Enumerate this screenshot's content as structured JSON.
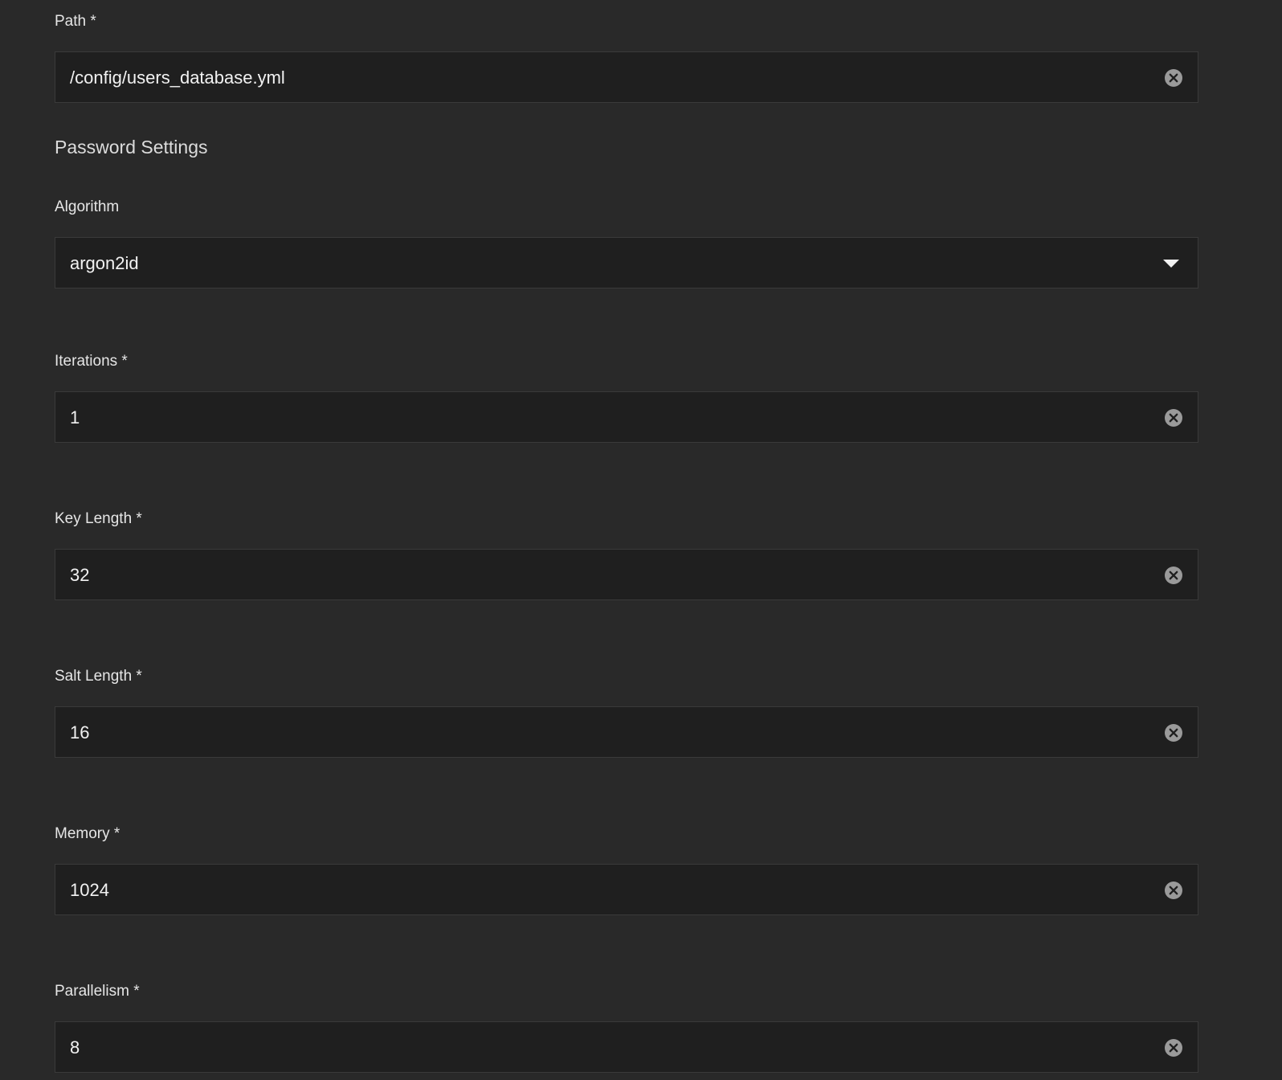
{
  "path": {
    "label": "Path *",
    "value": "/config/users_database.yml",
    "clear_icon": "close-circle-icon"
  },
  "password_settings": {
    "heading": "Password Settings",
    "algorithm": {
      "label": "Algorithm",
      "value": "argon2id",
      "dropdown_icon": "chevron-down-icon"
    },
    "iterations": {
      "label": "Iterations *",
      "value": "1",
      "clear_icon": "close-circle-icon"
    },
    "key_length": {
      "label": "Key Length *",
      "value": "32",
      "clear_icon": "close-circle-icon"
    },
    "salt_length": {
      "label": "Salt Length *",
      "value": "16",
      "clear_icon": "close-circle-icon"
    },
    "memory": {
      "label": "Memory *",
      "value": "1024",
      "clear_icon": "close-circle-icon"
    },
    "parallelism": {
      "label": "Parallelism *",
      "value": "8",
      "clear_icon": "close-circle-icon"
    }
  },
  "colors": {
    "background": "#292929",
    "field_background": "#1f1f1f",
    "field_border": "#3a3a3a",
    "label_text": "#e6e6e6",
    "value_text": "#f2f2f2",
    "icon": "#9a9a9a"
  }
}
